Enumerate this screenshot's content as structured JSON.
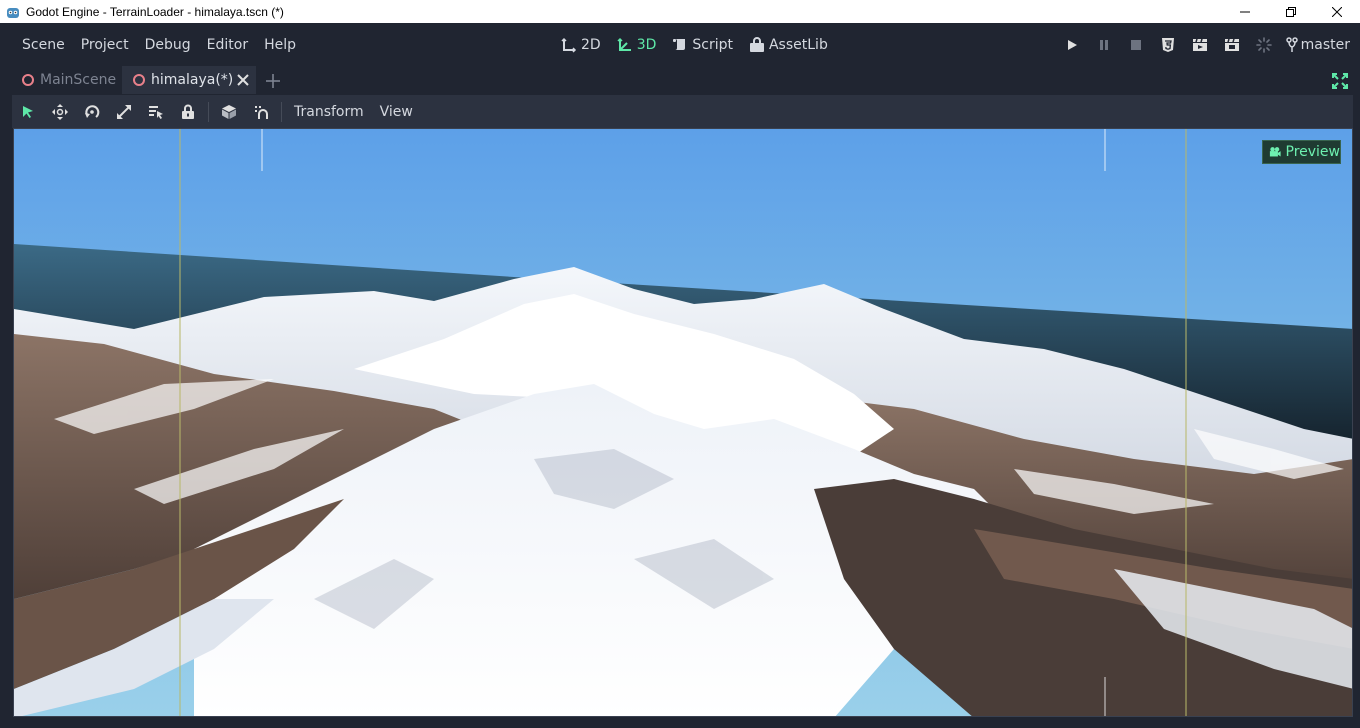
{
  "window": {
    "title": "Godot Engine - TerrainLoader - himalaya.tscn (*)",
    "app_icon": "godot-logo-icon",
    "controls": [
      "minimize-icon",
      "restore-icon",
      "close-icon"
    ]
  },
  "menu": {
    "items": [
      "Scene",
      "Project",
      "Debug",
      "Editor",
      "Help"
    ]
  },
  "workspaces": {
    "items": [
      {
        "label": "2D",
        "icon": "2d-icon",
        "active": false
      },
      {
        "label": "3D",
        "icon": "3d-icon",
        "active": true
      },
      {
        "label": "Script",
        "icon": "script-icon",
        "active": false
      },
      {
        "label": "AssetLib",
        "icon": "assetlib-icon",
        "active": false
      }
    ],
    "active_color": "#5ee8a8"
  },
  "run_controls": [
    "play-icon",
    "pause-icon",
    "stop-icon",
    "html5-icon",
    "play-scene-icon",
    "play-custom-scene-icon",
    "spinner-icon"
  ],
  "vcs": {
    "branch": "master",
    "icon": "branch-icon"
  },
  "tabs": [
    {
      "label": "MainScene",
      "active": false
    },
    {
      "label": "himalaya(*)",
      "active": true
    }
  ],
  "toolbar": {
    "tools": [
      "select-icon",
      "move-icon",
      "rotate-icon",
      "scale-icon",
      "list-select-icon",
      "lock-icon",
      "local-space-icon",
      "snap-icon"
    ],
    "menus": [
      "Transform",
      "View"
    ]
  },
  "viewport": {
    "preview_label": "Preview",
    "preview_icon": "camera-icon",
    "accent": "#6ef0b0"
  }
}
